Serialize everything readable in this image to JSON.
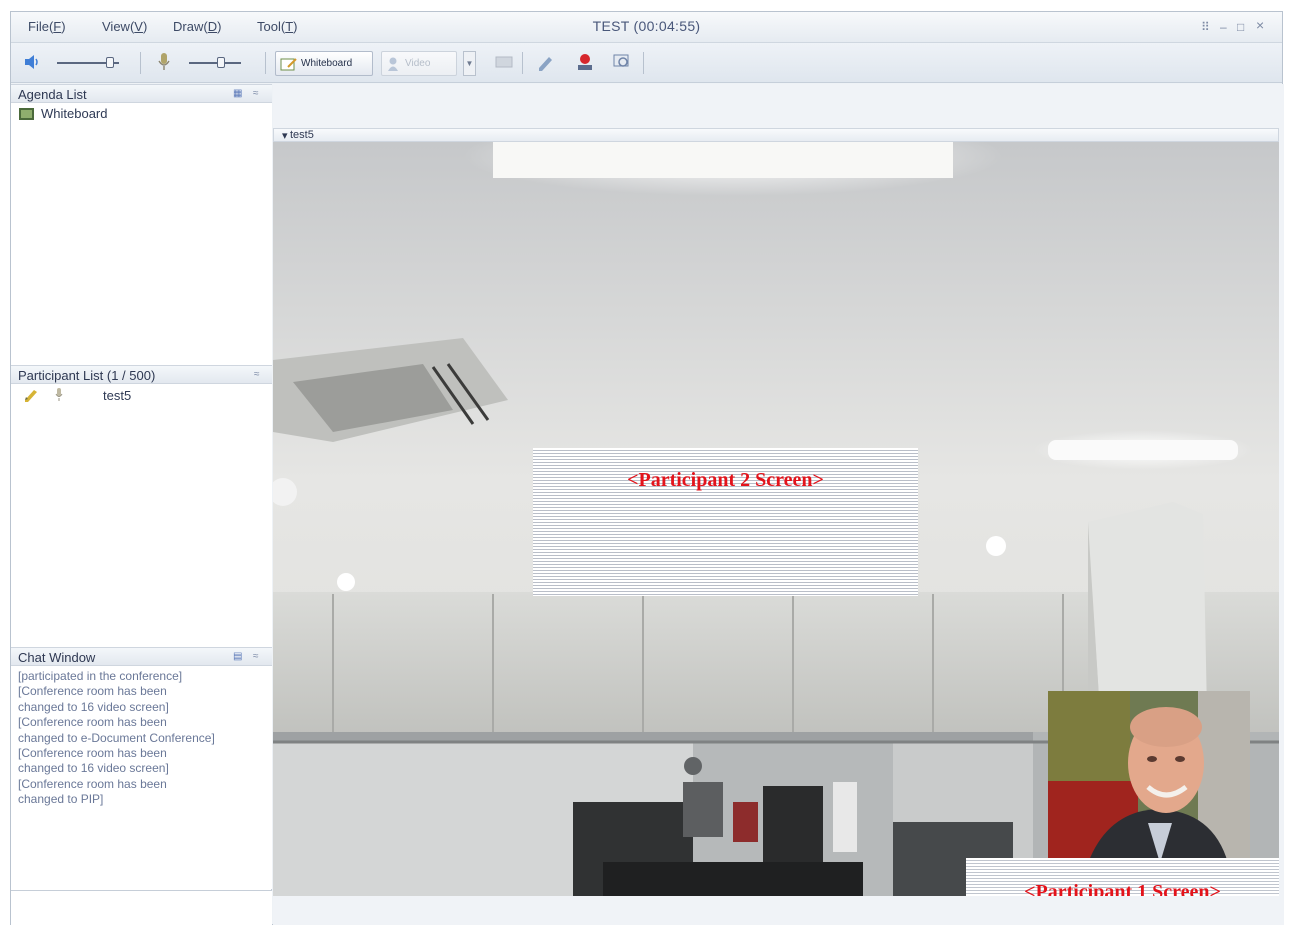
{
  "window": {
    "title": "TEST (00:04:55)",
    "controls": [
      "⠿",
      "–",
      "□",
      "×"
    ]
  },
  "menu": [
    {
      "label": "File",
      "key": "F"
    },
    {
      "label": "View",
      "key": "V"
    },
    {
      "label": "Draw",
      "key": "D"
    },
    {
      "label": "Tool",
      "key": "T"
    }
  ],
  "toolbar": {
    "speaker_icon": "speaker-icon",
    "mic_icon": "microphone-icon",
    "whiteboard_label": "Whiteboard",
    "video_label": "Video",
    "tool_icons": [
      "screen-share-icon",
      "edit-tool-icon",
      "record-icon",
      "capture-icon"
    ]
  },
  "agenda": {
    "title": "Agenda List",
    "items": [
      {
        "label": "Whiteboard",
        "icon": "whiteboard-icon"
      }
    ]
  },
  "participants": {
    "title": "Participant List (1 / 500)",
    "items": [
      {
        "name": "test5",
        "icons": [
          "pencil-icon",
          "microphone-icon"
        ]
      }
    ]
  },
  "chat": {
    "title": "Chat Window",
    "lines": [
      "[participated in the conference]",
      "[Conference room has been",
      "changed to 16 video screen]",
      "[Conference room has been",
      "changed to e-Document Conference]",
      "[Conference room has been",
      "changed to 16 video screen]",
      "[Conference room has been",
      "changed to PIP]"
    ],
    "input_value": ""
  },
  "main": {
    "tab_label": "test5",
    "participant2_label": "<Participant 2 Screen>",
    "participant1_label": "<Participant 1 Screen>"
  },
  "colors": {
    "overlay_text": "#e3131b",
    "frame_border": "#b9c3cf",
    "panel_header": "#e3e8ef"
  }
}
